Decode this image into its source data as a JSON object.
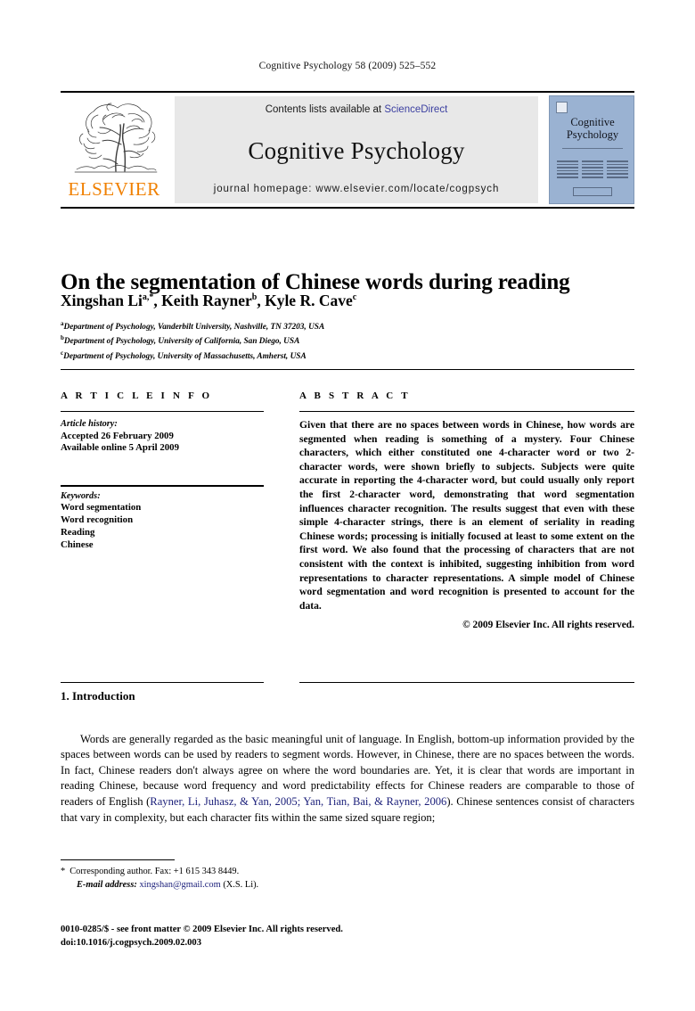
{
  "running_head": "Cognitive Psychology 58 (2009) 525–552",
  "masthead": {
    "publisher_name": "ELSEVIER",
    "publisher_logo": "elsevier-tree-logo",
    "contents_prefix": "Contents lists available at ",
    "contents_link": "ScienceDirect",
    "journal_name": "Cognitive Psychology",
    "homepage": "journal homepage: www.elsevier.com/locate/cogpsych",
    "cover": {
      "title_line1": "Cognitive",
      "title_line2": "Psychology"
    },
    "colors": {
      "elsevier_orange": "#F08000",
      "link_blue": "#3b3fa0",
      "panel_grey": "#e8e8e8",
      "cover_blue": "#9ab2d2"
    }
  },
  "article": {
    "title": "On the segmentation of Chinese words during reading",
    "authors": [
      {
        "name": "Xingshan Li",
        "marks": "a,*"
      },
      {
        "name": "Keith Rayner",
        "marks": "b"
      },
      {
        "name": "Kyle R. Cave",
        "marks": "c"
      }
    ],
    "authors_separator": ", ",
    "affiliations": [
      {
        "mark": "a",
        "text": "Department of Psychology, Vanderbilt University, Nashville, TN 37203, USA"
      },
      {
        "mark": "b",
        "text": "Department of Psychology, University of California, San Diego, USA"
      },
      {
        "mark": "c",
        "text": "Department of Psychology, University of Massachusetts, Amherst, USA"
      }
    ]
  },
  "article_info": {
    "heading": "A R T I C L E  I N F O",
    "history_label": "Article history:",
    "history": [
      "Accepted 26 February 2009",
      "Available online 5 April 2009"
    ],
    "keywords_label": "Keywords:",
    "keywords": [
      "Word segmentation",
      "Word recognition",
      "Reading",
      "Chinese"
    ]
  },
  "abstract": {
    "heading": "A B S T R A C T",
    "text": "Given that there are no spaces between words in Chinese, how words are segmented when reading is something of a mystery. Four Chinese characters, which either constituted one 4-character word or two 2-character words, were shown briefly to subjects. Subjects were quite accurate in reporting the 4-character word, but could usually only report the first 2-character word, demonstrating that word segmentation influences character recognition. The results suggest that even with these simple 4-character strings, there is an element of seriality in reading Chinese words; processing is initially focused at least to some extent on the first word. We also found that the processing of characters that are not consistent with the context is inhibited, suggesting inhibition from word representations to character representations. A simple model of Chinese word segmentation and word recognition is presented to account for the data.",
    "copyright": "© 2009 Elsevier Inc. All rights reserved."
  },
  "body": {
    "section_number": "1.",
    "section_title": "Introduction",
    "paragraph_part1": "Words are generally regarded as the basic meaningful unit of language. In English, bottom-up information provided by the spaces between words can be used by readers to segment words. However, in Chinese, there are no spaces between the words. In fact, Chinese readers don't always agree on where the word boundaries are. Yet, it is clear that words are important in reading Chinese, because word frequency and word predictability effects for Chinese readers are comparable to those of readers of English (",
    "citation": "Rayner, Li, Juhasz, & Yan, 2005; Yan, Tian, Bai, & Rayner, 2006",
    "paragraph_part2": "). Chinese sentences consist of characters that vary in complexity, but each character fits within the same sized square region;"
  },
  "footnotes": {
    "corresponding_marker": "*",
    "corresponding": "Corresponding author. Fax: +1 615 343 8449.",
    "email_label": "E-mail address:",
    "email": "xingshan@gmail.com",
    "email_owner": "(X.S. Li).",
    "issn_line": "0010-0285/$ - see front matter © 2009 Elsevier Inc. All rights reserved.",
    "doi_line": "doi:10.1016/j.cogpsych.2009.02.003"
  }
}
